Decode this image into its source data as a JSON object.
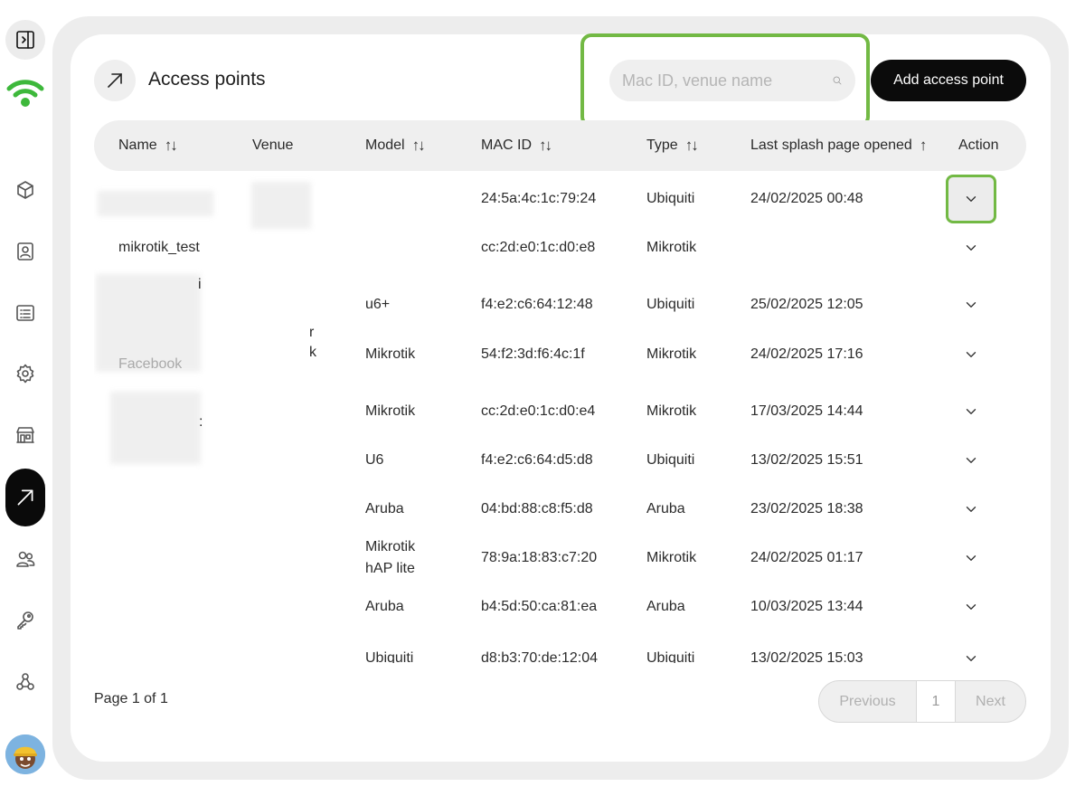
{
  "header": {
    "title": "Access points",
    "search_placeholder": "Mac ID, venue name",
    "add_button": "Add access point"
  },
  "table": {
    "columns": [
      {
        "label": "Name",
        "sort": "both"
      },
      {
        "label": "Venue",
        "sort": "none"
      },
      {
        "label": "Model",
        "sort": "both"
      },
      {
        "label": "MAC ID",
        "sort": "both"
      },
      {
        "label": "Type",
        "sort": "both"
      },
      {
        "label": "Last splash page opened",
        "sort": "up"
      },
      {
        "label": "Action",
        "sort": "none"
      }
    ],
    "rows": [
      {
        "name": "",
        "venue": "",
        "model": "",
        "mac": "24:5a:4c:1c:79:24",
        "type": "Ubiquiti",
        "last": "24/02/2025 00:48"
      },
      {
        "name": "mikrotik_test",
        "venue": "",
        "model": "",
        "mac": "cc:2d:e0:1c:d0:e8",
        "type": "Mikrotik",
        "last": ""
      },
      {
        "name": "i",
        "venue": "",
        "model": "u6+",
        "mac": "f4:e2:c6:64:12:48",
        "type": "Ubiquiti",
        "last": "25/02/2025 12:05"
      },
      {
        "name": "Facebook",
        "venue": "r\nk",
        "model": "Mikrotik",
        "mac": "54:f2:3d:f6:4c:1f",
        "type": "Mikrotik",
        "last": "24/02/2025 17:16"
      },
      {
        "name": ":",
        "venue": "",
        "model": "Mikrotik",
        "mac": "cc:2d:e0:1c:d0:e4",
        "type": "Mikrotik",
        "last": "17/03/2025 14:44"
      },
      {
        "name": "",
        "venue": "",
        "model": "U6",
        "mac": "f4:e2:c6:64:d5:d8",
        "type": "Ubiquiti",
        "last": "13/02/2025 15:51"
      },
      {
        "name": "",
        "venue": "",
        "model": "Aruba",
        "mac": "04:bd:88:c8:f5:d8",
        "type": "Aruba",
        "last": "23/02/2025 18:38"
      },
      {
        "name": "",
        "venue": "",
        "model": "Mikrotik\nhAP lite",
        "mac": "78:9a:18:83:c7:20",
        "type": "Mikrotik",
        "last": "24/02/2025 01:17"
      },
      {
        "name": "",
        "venue": "",
        "model": "Aruba",
        "mac": "b4:5d:50:ca:81:ea",
        "type": "Aruba",
        "last": "10/03/2025 13:44"
      },
      {
        "name": "",
        "venue": "",
        "model": "Ubiquiti",
        "mac": "d8:b3:70:de:12:04",
        "type": "Ubiquiti",
        "last": "13/02/2025 15:03"
      }
    ]
  },
  "footer": {
    "page_info": "Page 1 of 1",
    "previous": "Previous",
    "current_page": "1",
    "next": "Next"
  },
  "sidebar": {
    "items": [
      "sidebar-toggle-icon",
      "cube-icon",
      "contact-card-icon",
      "list-icon",
      "gear-icon",
      "store-icon",
      "arrow-up-right-icon",
      "users-icon",
      "key-icon",
      "webhook-icon"
    ],
    "active": "arrow-up-right-icon"
  },
  "colors": {
    "accent_highlight": "#72b944",
    "logo_green": "#3db83b",
    "primary_button": "#0b0b0b"
  }
}
